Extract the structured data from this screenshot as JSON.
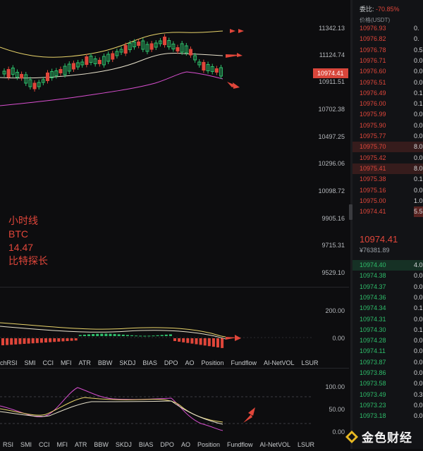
{
  "price_axis": {
    "ticks": [
      "11342.13",
      "11124.74",
      "10911.51",
      "10702.38",
      "10497.25",
      "10296.06",
      "10098.72",
      "9905.16",
      "9715.31",
      "9529.10"
    ],
    "current_price": "10974.41"
  },
  "indicator1_axis": [
    "200.00",
    "0.00"
  ],
  "indicator2_axis": [
    "100.00",
    "50.00",
    "0.00"
  ],
  "annotation": [
    "小时线",
    "BTC",
    "14.47",
    "比特探长"
  ],
  "indicator_tabs": [
    "chRSI",
    "SMI",
    "CCI",
    "MFI",
    "ATR",
    "BBW",
    "SKDJ",
    "BIAS",
    "DPO",
    "AO",
    "Position",
    "Fundflow",
    "AI-NetVOL",
    "LSUR"
  ],
  "indicator_tabs_bottom": [
    "RSI",
    "SMI",
    "CCI",
    "MFI",
    "ATR",
    "BBW",
    "SKDJ",
    "BIAS",
    "DPO",
    "AO",
    "Position",
    "Fundflow",
    "AI-NetVOL",
    "LSUR"
  ],
  "order_book": {
    "ratio_label": "委比",
    "ratio_value": "-70.85%",
    "col_header": "价格(USDT)",
    "asks": [
      {
        "price": "10976.93",
        "qty": "0."
      },
      {
        "price": "10976.82",
        "qty": "0."
      },
      {
        "price": "10976.78",
        "qty": "0.5"
      },
      {
        "price": "10976.71",
        "qty": "0.0"
      },
      {
        "price": "10976.60",
        "qty": "0.0"
      },
      {
        "price": "10976.51",
        "qty": "0.0"
      },
      {
        "price": "10976.49",
        "qty": "0.1"
      },
      {
        "price": "10976.00",
        "qty": "0.1"
      },
      {
        "price": "10975.99",
        "qty": "0.0"
      },
      {
        "price": "10975.90",
        "qty": "0.0"
      },
      {
        "price": "10975.77",
        "qty": "0.0"
      },
      {
        "price": "10975.70",
        "qty": "8.0"
      },
      {
        "price": "10975.42",
        "qty": "0.0"
      },
      {
        "price": "10975.41",
        "qty": "8.0"
      },
      {
        "price": "10975.38",
        "qty": "0.1"
      },
      {
        "price": "10975.16",
        "qty": "0.0"
      },
      {
        "price": "10975.00",
        "qty": "1.0"
      },
      {
        "price": "10974.41",
        "qty": "5.5"
      }
    ],
    "mid_price": "10974.41",
    "mid_sub": "¥76381.89",
    "bids": [
      {
        "price": "10974.40",
        "qty": "4.0"
      },
      {
        "price": "10974.38",
        "qty": "0.0"
      },
      {
        "price": "10974.37",
        "qty": "0.0"
      },
      {
        "price": "10974.36",
        "qty": "0.0"
      },
      {
        "price": "10974.34",
        "qty": "0.1"
      },
      {
        "price": "10974.31",
        "qty": "0.0"
      },
      {
        "price": "10974.30",
        "qty": "0.1"
      },
      {
        "price": "10974.28",
        "qty": "0.0"
      },
      {
        "price": "10974.11",
        "qty": "0.0"
      },
      {
        "price": "10973.87",
        "qty": "0.0"
      },
      {
        "price": "10973.86",
        "qty": "0.0"
      },
      {
        "price": "10973.58",
        "qty": "0.0"
      },
      {
        "price": "10973.49",
        "qty": "0.3"
      },
      {
        "price": "10973.23",
        "qty": "0.0"
      },
      {
        "price": "10973.18",
        "qty": "0.0"
      }
    ]
  },
  "watermark": "金色财经",
  "colors": {
    "up": "#2ebd6a",
    "down": "#e0463a",
    "ma_upper": "#e8d36a",
    "ma_mid": "#e8e2cc",
    "lower_band": "#d94fd0"
  }
}
